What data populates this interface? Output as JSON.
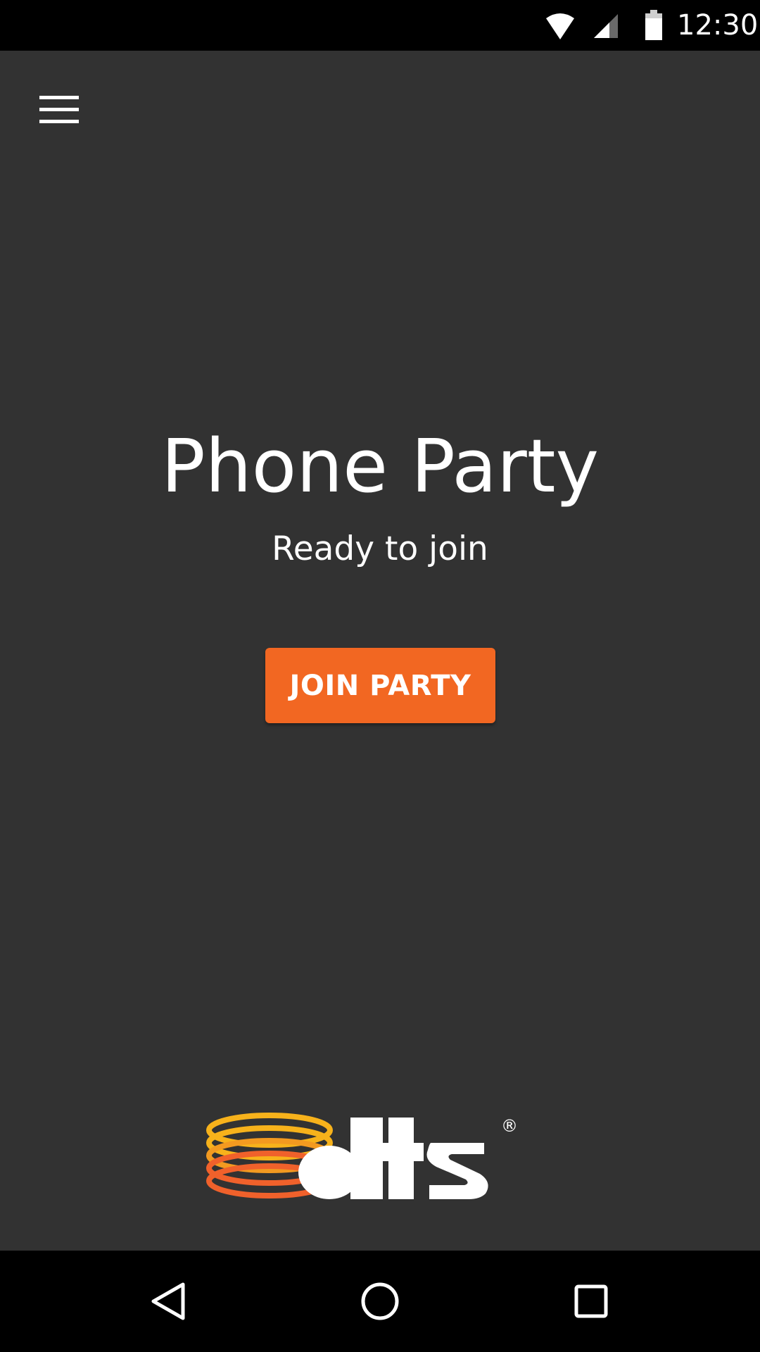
{
  "status_bar": {
    "time": "12:30",
    "icons": [
      "wifi-icon",
      "cell-signal-icon",
      "battery-icon"
    ]
  },
  "toolbar": {
    "menu_icon": "hamburger-menu-icon"
  },
  "main": {
    "title": "Phone Party",
    "subtitle": "Ready to join",
    "join_button_label": "JOIN PARTY"
  },
  "logo": {
    "brand_text": "dts",
    "registered_mark": "®"
  },
  "nav_bar": {
    "icons": [
      "back-icon",
      "home-icon",
      "recents-icon"
    ]
  },
  "colors": {
    "background": "#323232",
    "accent": "#f26722",
    "logo_yellow": "#f7b21b",
    "logo_orange": "#f0612b",
    "text": "#ffffff",
    "system_bars": "#000000"
  }
}
